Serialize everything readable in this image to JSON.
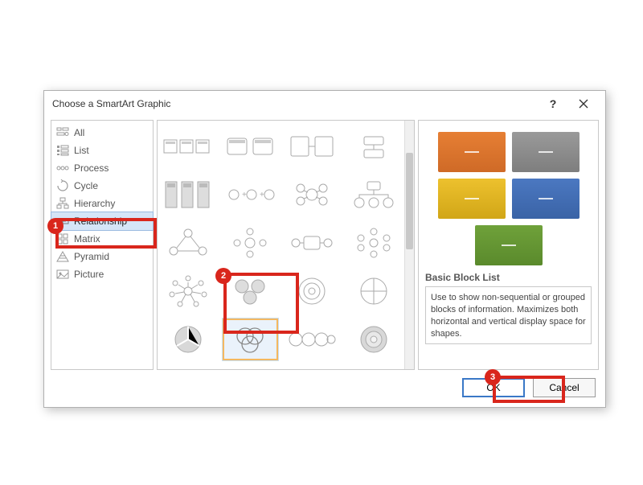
{
  "dialog": {
    "title": "Choose a SmartArt Graphic",
    "help_label": "?",
    "close_label": "Close"
  },
  "sidebar": {
    "items": [
      {
        "id": "all",
        "label": "All"
      },
      {
        "id": "list",
        "label": "List"
      },
      {
        "id": "process",
        "label": "Process"
      },
      {
        "id": "cycle",
        "label": "Cycle"
      },
      {
        "id": "hierarchy",
        "label": "Hierarchy"
      },
      {
        "id": "relationship",
        "label": "Relationship"
      },
      {
        "id": "matrix",
        "label": "Matrix"
      },
      {
        "id": "pyramid",
        "label": "Pyramid"
      },
      {
        "id": "picture",
        "label": "Picture"
      }
    ],
    "selected_id": "relationship"
  },
  "gallery": {
    "selected_index": 17
  },
  "preview": {
    "info_title": "Basic Block List",
    "info_desc": "Use to show non-sequential or grouped blocks of information. Maximizes both horizontal and vertical display space for shapes.",
    "colors": [
      "orange",
      "gray",
      "gold",
      "blue",
      "green"
    ]
  },
  "footer": {
    "ok_label": "OK",
    "cancel_label": "Cancel"
  },
  "callouts": {
    "1": "1",
    "2": "2",
    "3": "3"
  }
}
